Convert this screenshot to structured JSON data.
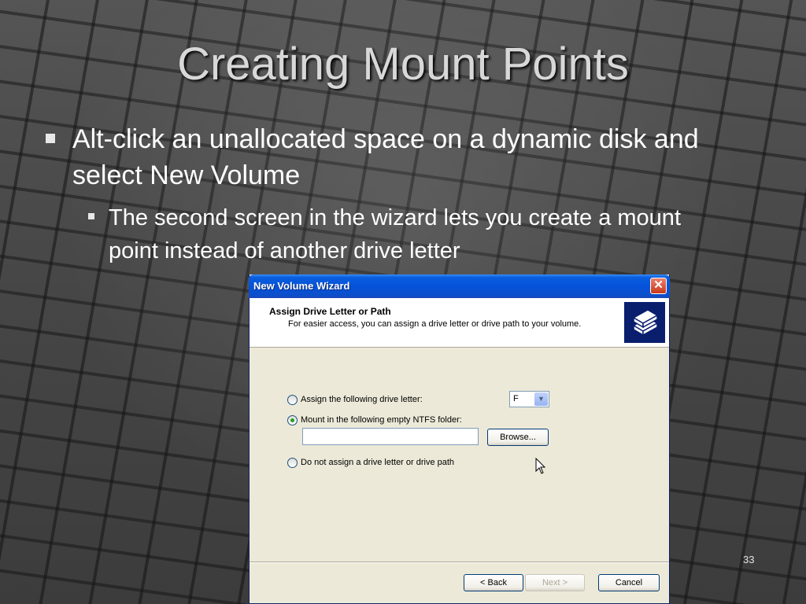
{
  "slide": {
    "title": "Creating Mount Points",
    "bullet1": "Alt-click an unallocated space on a dynamic disk and select New Volume",
    "bullet2": "The second screen in the wizard lets you create a mount point instead of another drive letter",
    "page_number": "33"
  },
  "dialog": {
    "title": "New Volume Wizard",
    "close_label": "✕",
    "header_title": "Assign Drive Letter or Path",
    "header_subtitle": "For easier access, you can assign a drive letter or drive path to your volume.",
    "icon": "disk-stack-icon",
    "options": [
      {
        "label": "Assign the following drive letter:",
        "checked": false
      },
      {
        "label": "Mount in the following empty NTFS folder:",
        "checked": true
      },
      {
        "label": "Do not assign a drive letter or drive path",
        "checked": false
      }
    ],
    "drive_letter": "F",
    "folder_path": "",
    "browse_label": "Browse...",
    "back_label": "< Back",
    "next_label": "Next >",
    "cancel_label": "Cancel"
  },
  "colors": {
    "titlebar": "#0553d8",
    "dialog_bg": "#ece9d8",
    "radio_dot": "#21a121"
  }
}
